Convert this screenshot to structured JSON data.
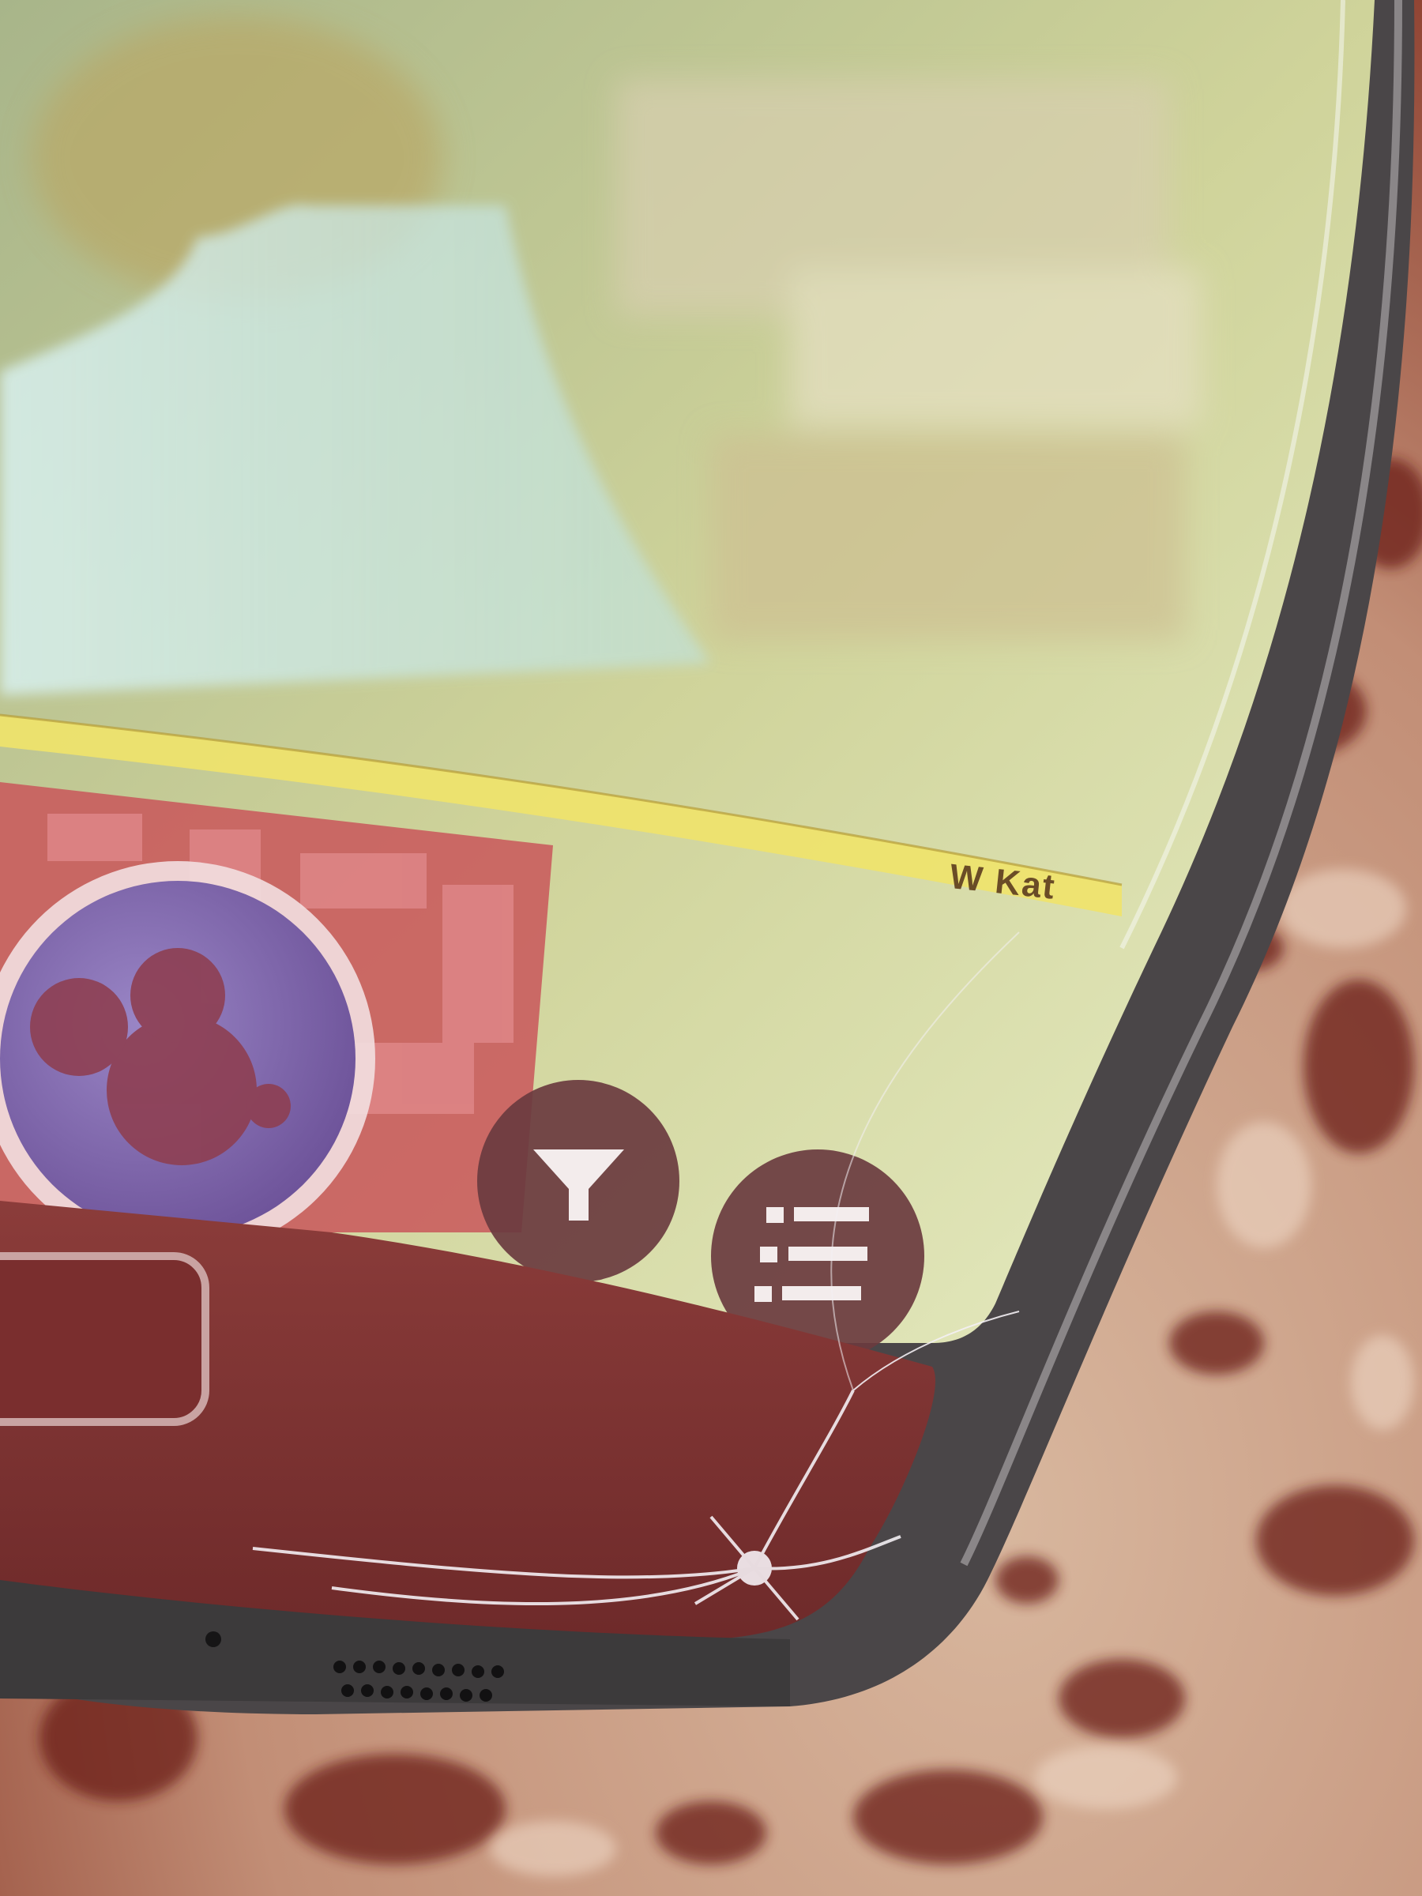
{
  "photo": {
    "subject": "",
    "colors": {
      "granite_light": "#d8b79e",
      "granite_dark": "#6b1e16",
      "phone_frame": "#4a4648",
      "screen_map_green": "#c9cf86",
      "map_red_area": "#c9565a",
      "disney_button_purple": "#7b5fa6",
      "map_button": "#6a3b3f",
      "highway_yellow": "#efe36a",
      "glass_glare": "#dff2f2"
    }
  },
  "map": {
    "street_label": "W Kat"
  },
  "buttons": {
    "disney_icon": "mickey-mouse-icon",
    "filter_icon": "filter-icon",
    "list_icon": "list-icon"
  }
}
